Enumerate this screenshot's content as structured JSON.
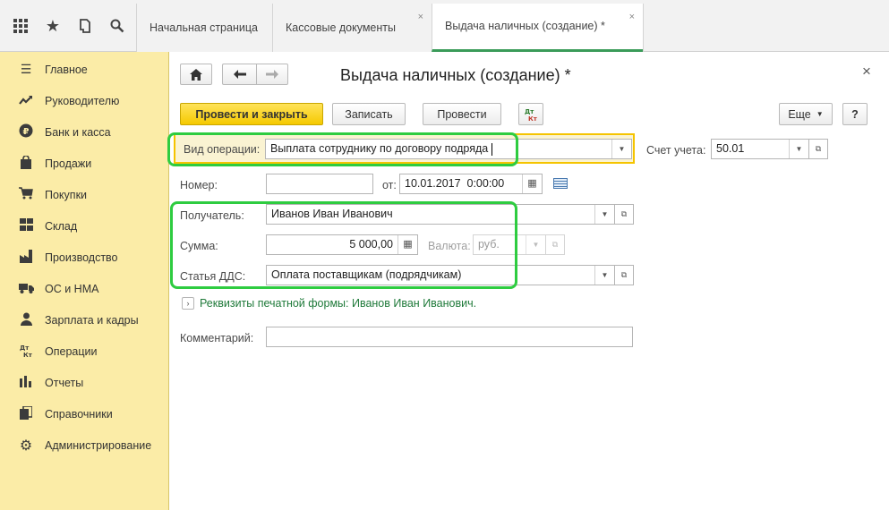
{
  "tabs": [
    {
      "label": "Начальная страница"
    },
    {
      "label": "Кассовые документы"
    },
    {
      "label": "Выдача наличных (создание) *"
    }
  ],
  "sidebar": {
    "items": [
      {
        "label": "Главное",
        "icon": "menu-icon"
      },
      {
        "label": "Руководителю",
        "icon": "trend-icon"
      },
      {
        "label": "Банк и касса",
        "icon": "ruble-icon"
      },
      {
        "label": "Продажи",
        "icon": "bag-icon"
      },
      {
        "label": "Покупки",
        "icon": "cart-icon"
      },
      {
        "label": "Склад",
        "icon": "warehouse-icon"
      },
      {
        "label": "Производство",
        "icon": "factory-icon"
      },
      {
        "label": "ОС и НМА",
        "icon": "truck-icon"
      },
      {
        "label": "Зарплата и кадры",
        "icon": "people-icon"
      },
      {
        "label": "Операции",
        "icon": "dt-kt-icon"
      },
      {
        "label": "Отчеты",
        "icon": "bar-chart-icon"
      },
      {
        "label": "Справочники",
        "icon": "books-icon"
      },
      {
        "label": "Администрирование",
        "icon": "gear-icon"
      }
    ]
  },
  "form": {
    "title": "Выдача наличных (создание) *",
    "buttons": {
      "post_close": "Провести и закрыть",
      "save": "Записать",
      "post": "Провести",
      "more": "Еще",
      "help": "?"
    },
    "operation_label": "Вид операции:",
    "operation_value": "Выплата сотруднику по договору подряда",
    "account_label": "Счет учета:",
    "account_value": "50.01",
    "number_label": "Номер:",
    "number_value": "",
    "date_label": "от:",
    "date_value": "10.01.2017  0:00:00",
    "recipient_label": "Получатель:",
    "recipient_value": "Иванов Иван Иванович",
    "sum_label": "Сумма:",
    "sum_value": "5 000,00",
    "currency_label": "Валюта:",
    "currency_value": "руб.",
    "dds_label": "Статья ДДС:",
    "dds_value": "Оплата поставщикам (подрядчикам)",
    "print_details": "Реквизиты печатной формы: Иванов Иван Иванович.",
    "comment_label": "Комментарий:",
    "comment_value": ""
  },
  "colors": {
    "sidebar_bg": "#fbeca7",
    "primary_button": "#f5c900",
    "active_tab_underline": "#3a9b59",
    "highlight_outline": "#2ecc40",
    "focus_border": "#f5c400",
    "link_green": "#1f7a3a"
  }
}
